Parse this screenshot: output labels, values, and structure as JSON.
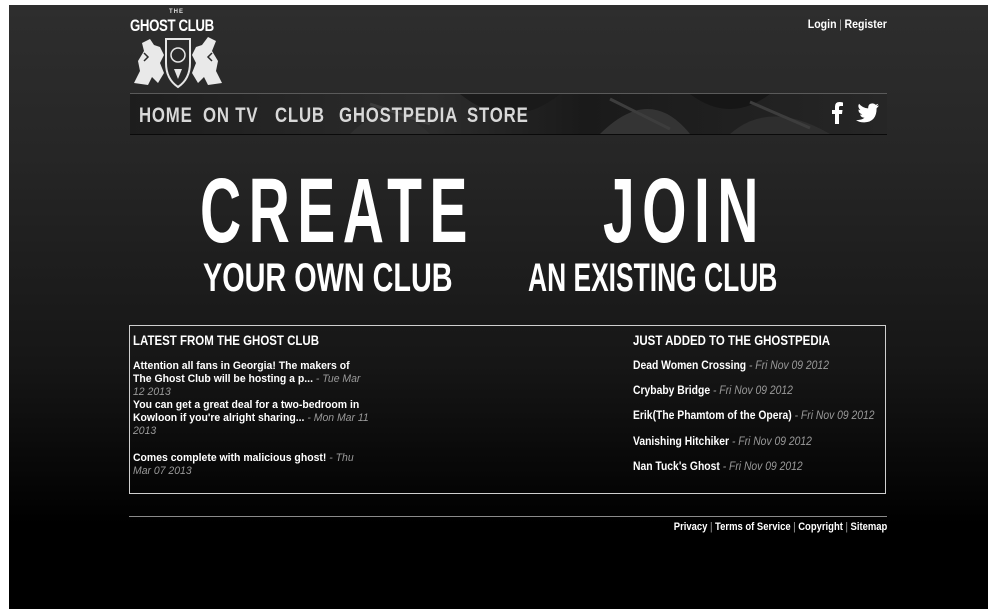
{
  "logo": {
    "small_text": "THE",
    "name": "GHOST CLUB"
  },
  "auth": {
    "login": "Login",
    "separator": "|",
    "register": "Register"
  },
  "nav": {
    "items": [
      {
        "label": "HOME"
      },
      {
        "label": "ON TV"
      },
      {
        "label": "CLUB"
      },
      {
        "label": "GHOSTPEDIA"
      },
      {
        "label": "STORE"
      }
    ],
    "social": [
      "facebook-icon",
      "twitter-icon"
    ]
  },
  "hero": {
    "create": {
      "big": "CREATE",
      "sub": "YOUR OWN CLUB"
    },
    "join": {
      "big": "JOIN",
      "sub": "AN EXISTING CLUB"
    }
  },
  "latest": {
    "title": "LATEST FROM THE GHOST CLUB",
    "items": [
      {
        "text": "Attention all fans in Georgia! The makers of The Ghost Club will be hosting a p...",
        "date": "- Tue Mar 12 2013"
      },
      {
        "text": "You can get a great deal for a two-bedroom in Kowloon if you're alright sharing...",
        "date": "- Mon Mar 11 2013"
      },
      {
        "text": "Comes complete with malicious ghost!",
        "date": "- Thu Mar 07 2013"
      }
    ]
  },
  "ghostpedia": {
    "title": "JUST ADDED TO THE GHOSTPEDIA",
    "items": [
      {
        "name": "Dead Women Crossing",
        "date": "- Fri Nov 09 2012"
      },
      {
        "name": "Crybaby Bridge",
        "date": "- Fri Nov 09 2012"
      },
      {
        "name": "Erik(The Phamtom of the Opera)",
        "date": "- Fri Nov 09 2012"
      },
      {
        "name": "Vanishing Hitchiker",
        "date": "- Fri Nov 09 2012"
      },
      {
        "name": "Nan Tuck's Ghost",
        "date": "- Fri Nov 09 2012"
      }
    ]
  },
  "footer": {
    "separator": "|",
    "links": [
      "Privacy",
      "Terms of Service",
      "Copyright",
      "Sitemap"
    ]
  },
  "colors": {
    "background_top": "#2e2e2e",
    "background_bottom": "#000000",
    "text": "#ffffff",
    "date": "#9a9a9a",
    "nav_text": "#d8d8d8"
  }
}
